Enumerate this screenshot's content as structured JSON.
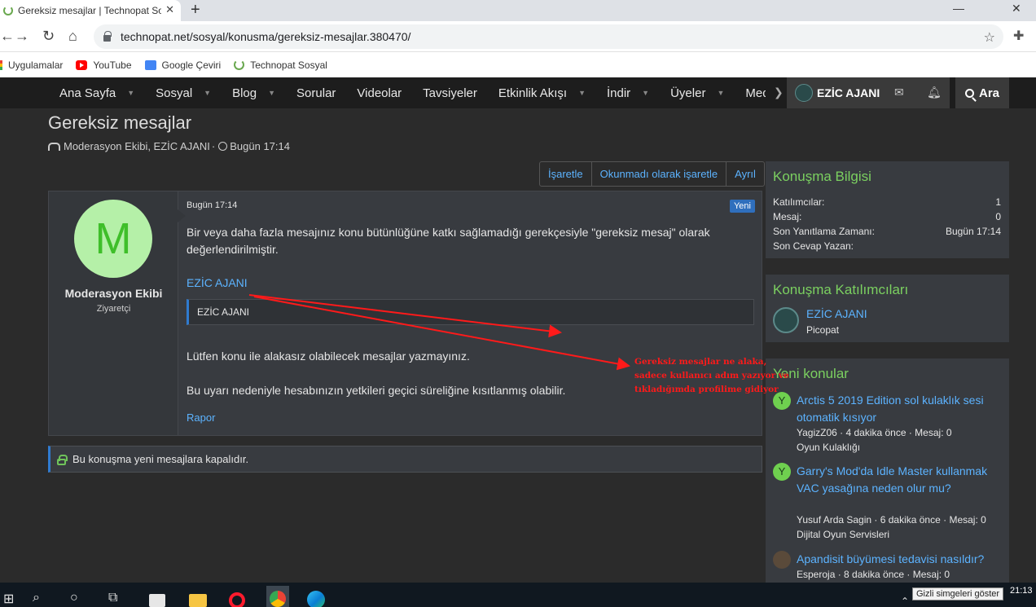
{
  "browser": {
    "tab_title": "Gereksiz mesajlar | Technopat Sosyal",
    "tab_close": "✕",
    "new_tab": "+",
    "url": "technopat.net/sosyal/konusma/gereksiz-mesajlar.380470/",
    "bookmarks": [
      "Uygulamalar",
      "YouTube",
      "Google Çeviri",
      "Technopat Sosyal"
    ]
  },
  "nav": {
    "items": [
      "Ana Sayfa",
      "Sosyal",
      "Blog",
      "Sorular",
      "Videolar",
      "Tavsiyeler",
      "Etkinlik Akışı",
      "İndir",
      "Üyeler",
      "Medya"
    ],
    "username": "EZİC AJANI",
    "search": "Ara"
  },
  "page": {
    "title": "Gereksiz mesajlar",
    "participants": "Moderasyon Ekibi, EZİC AJANI",
    "meta_sep": "·",
    "date": "Bugün 17:14"
  },
  "actions": [
    "İşaretle",
    "Okunmadı olarak işaretle",
    "Ayrıl"
  ],
  "message": {
    "avatar_letter": "M",
    "author": "Moderasyon Ekibi",
    "author_title": "Ziyaretçi",
    "date": "Bugün 17:14",
    "badge": "Yeni",
    "p1": "Bir veya daha fazla mesajınız konu bütünlüğüne katkı sağlamadığı gerekçesiyle \"gereksiz mesaj\" olarak değerlendirilmiştir.",
    "mention": "EZİC AJANI",
    "quote": "EZİC AJANI",
    "p2": "Lütfen konu ile alakasız olabilecek mesajlar yazmayınız.",
    "p3": "Bu uyarı nedeniyle hesabınızın yetkileri geçici süreliğine kısıtlanmış olabilir.",
    "report": "Rapor"
  },
  "closed_notice": "Bu konuşma yeni mesajlara kapalıdır.",
  "sidebar": {
    "info": {
      "title": "Konuşma Bilgisi",
      "rows": [
        {
          "label": "Katılımcılar:",
          "value": "1"
        },
        {
          "label": "Mesaj:",
          "value": "0"
        },
        {
          "label": "Son Yanıtlama Zamanı:",
          "value": "Bugün 17:14"
        },
        {
          "label": "Son Cevap Yazan:",
          "value": ""
        }
      ]
    },
    "participants": {
      "title": "Konuşma Katılımcıları",
      "name": "EZİC AJANI",
      "role": "Picopat"
    },
    "new_topics": {
      "title": "Yeni konular",
      "topics": [
        {
          "avatar": "Y",
          "title": "Arctis 5 2019 Edition sol kulaklık sesi otomatik kısıyor",
          "meta": "YagizZ06 · 4 dakika önce · Mesaj: 0",
          "forum": "Oyun Kulaklığı"
        },
        {
          "avatar": "Y",
          "title": "Garry's Mod'da Idle Master kullanmak VAC yasağına neden olur mu?",
          "meta": "Yusuf Arda Sagin · 6 dakika önce · Mesaj: 0",
          "forum": "Dijital Oyun Servisleri"
        },
        {
          "avatar": "",
          "title": "Apandisit büyümesi tedavisi nasıldır?",
          "meta": "Esperoja · 8 dakika önce · Mesaj: 0",
          "forum": ""
        }
      ]
    }
  },
  "annotation": {
    "line1": "Gereksiz mesajlar ne alaka,",
    "line2": "sadece kullanıcı adım yazıyor ve",
    "line3": "tıkladığımda profilime gidiyor",
    "color": "#ff1a1a"
  },
  "taskbar": {
    "tooltip": "Gizli simgeleri göster",
    "time": "21:13"
  }
}
